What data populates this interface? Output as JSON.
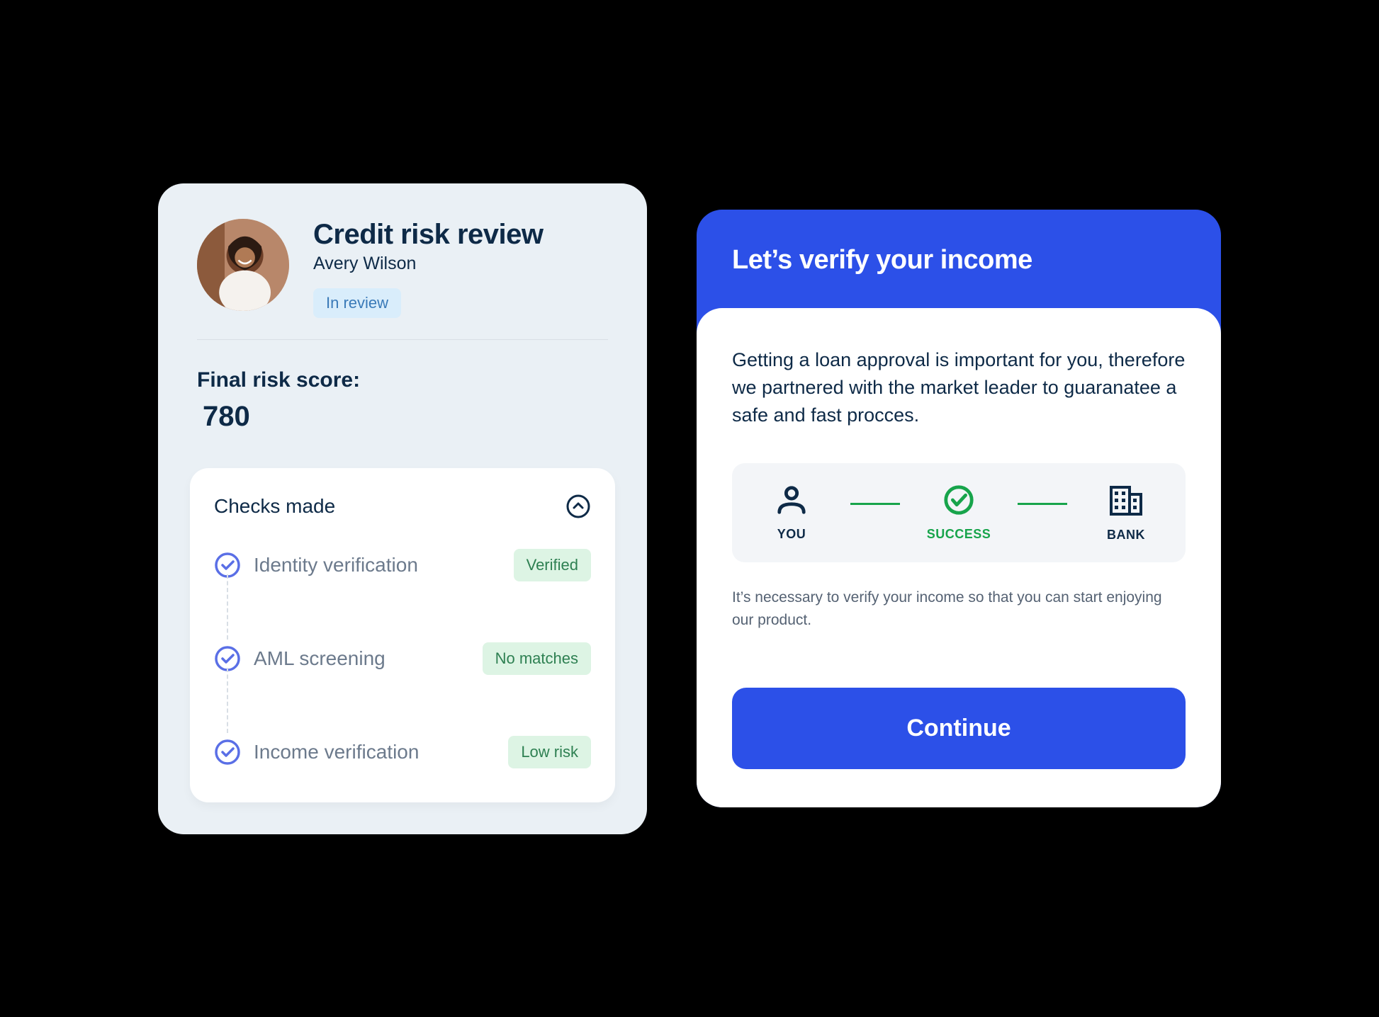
{
  "review": {
    "title": "Credit risk review",
    "name": "Avery Wilson",
    "status": "In review",
    "score_label": "Final risk score:",
    "score_value": "780",
    "checks_heading": "Checks made",
    "checks": [
      {
        "label": "Identity verification",
        "badge": "Verified"
      },
      {
        "label": "AML screening",
        "badge": "No matches"
      },
      {
        "label": "Income verification",
        "badge": "Low risk"
      }
    ]
  },
  "verify": {
    "title": "Let’s verify your income",
    "intro": "Getting a loan approval is important for you, therefore we partnered with the market leader to guaranatee a safe and fast procces.",
    "steps": {
      "you": "YOU",
      "success": "SUCCESS",
      "bank": "BANK"
    },
    "note": "It’s necessary to verify your income so that you can start enjoying our product.",
    "continue": "Continue"
  }
}
